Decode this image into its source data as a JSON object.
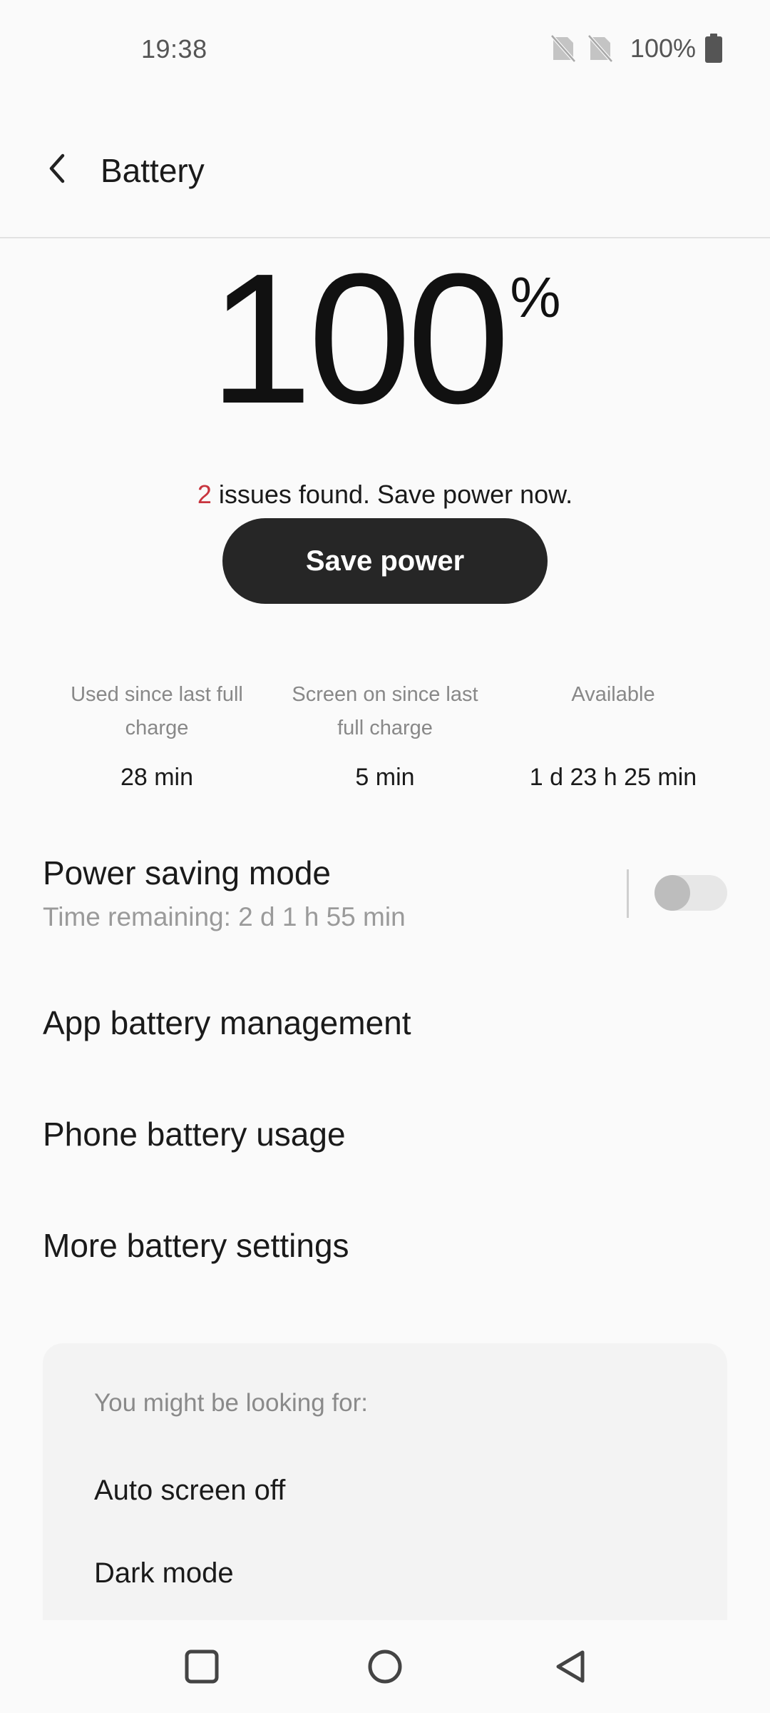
{
  "status_bar": {
    "time": "19:38",
    "battery_percent": "100%",
    "icons": [
      "no-sim-icon",
      "no-sim-icon",
      "battery-full-icon"
    ]
  },
  "header": {
    "title": "Battery",
    "back_icon": "chevron-left-icon"
  },
  "battery": {
    "level": "100",
    "level_unit": "%",
    "level_fraction": 1.0
  },
  "issues": {
    "count": "2",
    "text": " issues found. Save power now.",
    "count_color": "#c8343e"
  },
  "save_button": {
    "label": "Save power"
  },
  "stats": [
    {
      "label": "Used since last full charge",
      "value": "28 min"
    },
    {
      "label": "Screen on since last full charge",
      "value": "5 min"
    },
    {
      "label": "Available",
      "value": "1 d 23 h 25 min"
    }
  ],
  "power_saving": {
    "title": "Power saving mode",
    "subtitle": "Time remaining:  2 d 1 h 55 min",
    "enabled": false
  },
  "menu": {
    "app_battery": "App battery management",
    "phone_usage": "Phone battery usage",
    "more_settings": "More battery settings"
  },
  "suggestions": {
    "title": "You might be looking for:",
    "items": [
      "Auto screen off",
      "Dark mode"
    ]
  },
  "nav_bar": {
    "icons": [
      "recent-apps-icon",
      "home-icon",
      "back-icon"
    ]
  },
  "colors": {
    "background": "#fafafa",
    "button": "#262626",
    "accent_red": "#c8343e"
  }
}
